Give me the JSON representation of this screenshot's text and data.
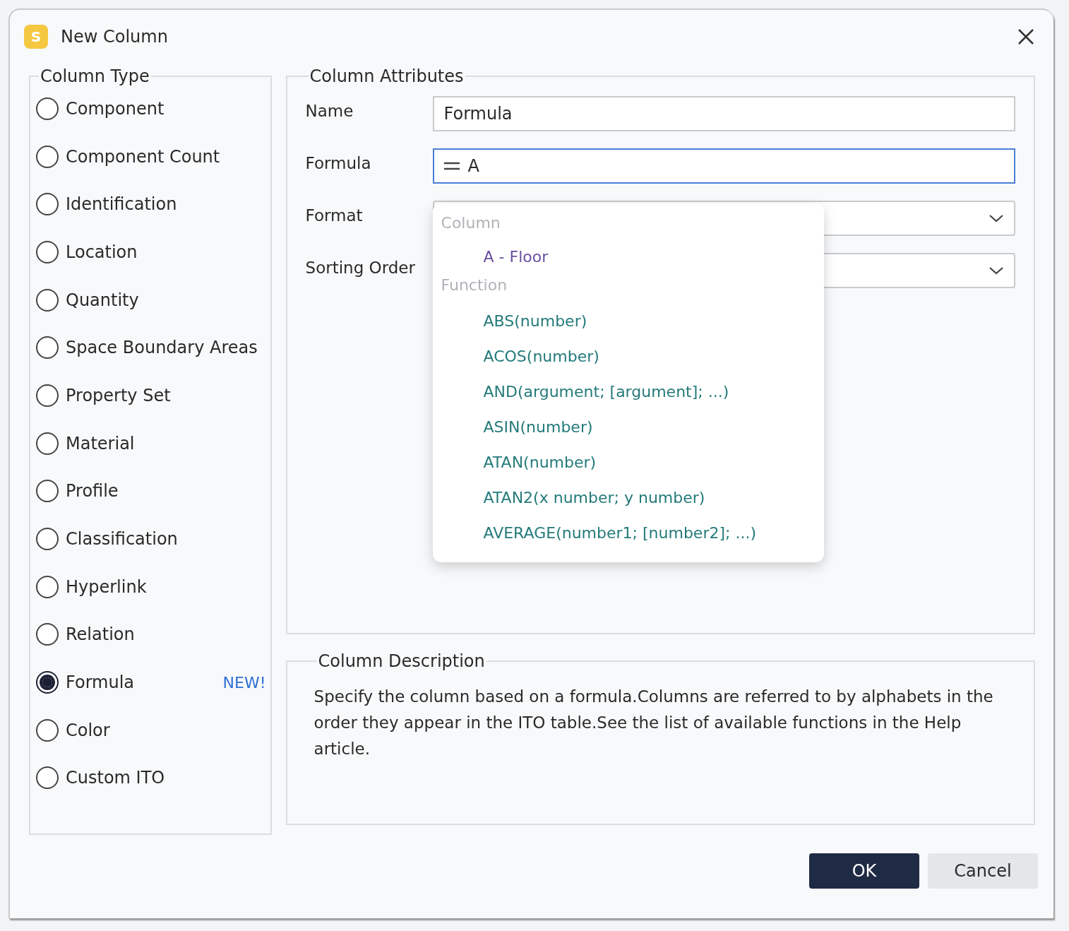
{
  "window": {
    "title": "New Column",
    "app_icon": "S"
  },
  "column_type": {
    "legend": "Column Type",
    "options": [
      {
        "label": "Component",
        "selected": false
      },
      {
        "label": "Component Count",
        "selected": false
      },
      {
        "label": "Identification",
        "selected": false
      },
      {
        "label": "Location",
        "selected": false
      },
      {
        "label": "Quantity",
        "selected": false
      },
      {
        "label": "Space Boundary Areas",
        "selected": false
      },
      {
        "label": "Property Set",
        "selected": false
      },
      {
        "label": "Material",
        "selected": false
      },
      {
        "label": "Profile",
        "selected": false
      },
      {
        "label": "Classification",
        "selected": false
      },
      {
        "label": "Hyperlink",
        "selected": false
      },
      {
        "label": "Relation",
        "selected": false
      },
      {
        "label": "Formula",
        "selected": true,
        "badge": "NEW!"
      },
      {
        "label": "Color",
        "selected": false
      },
      {
        "label": "Custom ITO",
        "selected": false
      }
    ]
  },
  "column_attributes": {
    "legend": "Column Attributes",
    "fields": [
      {
        "label": "Name",
        "kind": "text",
        "value": "Formula"
      },
      {
        "label": "Formula",
        "kind": "formula",
        "value": "A",
        "focused": true
      },
      {
        "label": "Format",
        "kind": "select"
      },
      {
        "label": "Sorting Order",
        "kind": "select"
      }
    ]
  },
  "autocomplete": {
    "groups": [
      {
        "heading": "Column",
        "kind": "column",
        "items": [
          "A - Floor"
        ]
      },
      {
        "heading": "Function",
        "kind": "function",
        "items": [
          "ABS(number)",
          "ACOS(number)",
          "AND(argument; [argument]; ...)",
          "ASIN(number)",
          "ATAN(number)",
          "ATAN2(x number; y number)",
          "AVERAGE(number1; [number2]; ...)"
        ]
      }
    ]
  },
  "column_description": {
    "legend": "Column Description",
    "text": "Specify the column based on a formula.Columns are referred to by alphabets in the order they appear in the ITO table.See the list of available functions in the Help article."
  },
  "buttons": [
    {
      "label": "OK",
      "kind": "primary"
    },
    {
      "label": "Cancel",
      "kind": "secondary"
    }
  ]
}
